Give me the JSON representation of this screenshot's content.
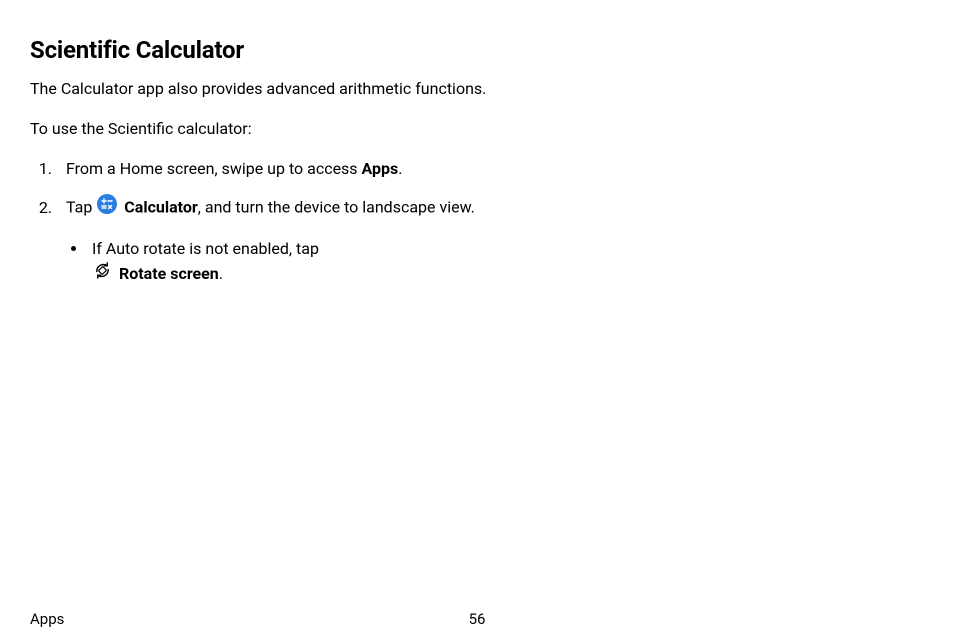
{
  "heading": "Scientific Calculator",
  "intro": "The Calculator app also provides advanced arithmetic functions.",
  "lead": "To use the Scientific calculator:",
  "step1_pre": "From a Home screen, swipe up to access ",
  "step1_bold": "Apps",
  "step1_post": ".",
  "step2_pre": "Tap ",
  "step2_icon_name": "calculator-icon",
  "step2_bold": "Calculator",
  "step2_post": ", and turn the device to landscape view.",
  "sub1_pre": "If Auto rotate is not enabled, tap ",
  "sub1_icon_name": "rotate-screen-icon",
  "sub1_bold": "Rotate screen",
  "sub1_post": ".",
  "footer_section": "Apps",
  "footer_page": "56"
}
